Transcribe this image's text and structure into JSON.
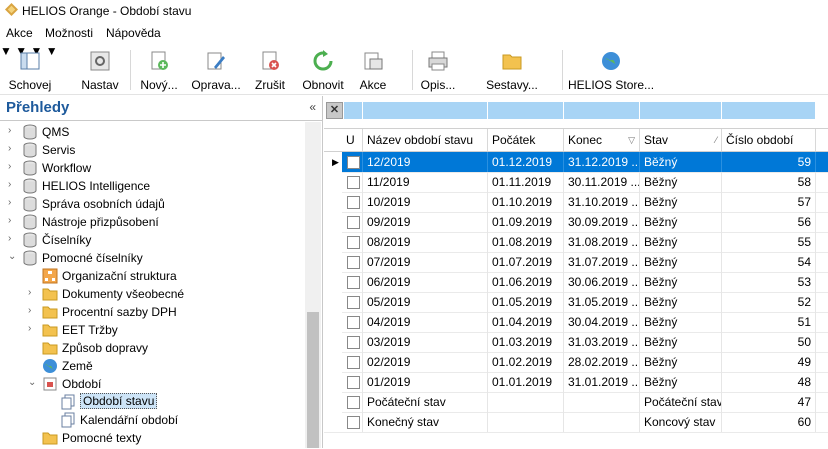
{
  "window": {
    "title": "HELIOS Orange - Období stavu"
  },
  "menu": [
    "Akce",
    "Možnosti",
    "Nápověda"
  ],
  "toolbar": [
    {
      "label": "Schovej",
      "icon": "hide-panel-icon",
      "dropdown": true
    },
    {
      "label": "Nastav",
      "icon": "settings-icon",
      "dropdown": false
    },
    {
      "label": "Nový...",
      "icon": "new-document-icon",
      "dropdown": false
    },
    {
      "label": "Oprava...",
      "icon": "edit-icon",
      "dropdown": false
    },
    {
      "label": "Zrušit",
      "icon": "delete-icon",
      "dropdown": false
    },
    {
      "label": "Obnovit",
      "icon": "refresh-icon",
      "dropdown": false
    },
    {
      "label": "Akce",
      "icon": "actions-icon",
      "dropdown": true
    },
    {
      "label": "Opis...",
      "icon": "print-icon",
      "dropdown": true
    },
    {
      "label": "Sestavy...",
      "icon": "folder-icon",
      "dropdown": true
    },
    {
      "label": "HELIOS Store...",
      "icon": "globe-icon",
      "dropdown": false
    }
  ],
  "left_panel": {
    "title": "Přehledy",
    "collapse": "«",
    "tree": [
      {
        "label": "QMS",
        "level": 0,
        "icon": "database-icon",
        "expander": ">"
      },
      {
        "label": "Servis",
        "level": 0,
        "icon": "database-icon",
        "expander": ">"
      },
      {
        "label": "Workflow",
        "level": 0,
        "icon": "database-icon",
        "expander": ">"
      },
      {
        "label": "HELIOS Intelligence",
        "level": 0,
        "icon": "database-icon",
        "expander": ">"
      },
      {
        "label": "Správa osobních údajů",
        "level": 0,
        "icon": "database-icon",
        "expander": ">"
      },
      {
        "label": "Nástroje přizpůsobení",
        "level": 0,
        "icon": "database-icon",
        "expander": ">"
      },
      {
        "label": "Číselníky",
        "level": 0,
        "icon": "database-icon",
        "expander": ">"
      },
      {
        "label": "Pomocné číselníky",
        "level": 0,
        "icon": "database-icon",
        "expander": "v"
      },
      {
        "label": "Organizační struktura",
        "level": 1,
        "icon": "org-chart-icon",
        "expander": ""
      },
      {
        "label": "Dokumenty všeobecné",
        "level": 1,
        "icon": "folder-icon",
        "expander": ">"
      },
      {
        "label": "Procentní sazby DPH",
        "level": 1,
        "icon": "folder-icon",
        "expander": ">"
      },
      {
        "label": "EET Tržby",
        "level": 1,
        "icon": "folder-icon",
        "expander": ">"
      },
      {
        "label": "Způsob dopravy",
        "level": 1,
        "icon": "folder-icon",
        "expander": ""
      },
      {
        "label": "Země",
        "level": 1,
        "icon": "globe-icon",
        "expander": ""
      },
      {
        "label": "Období",
        "level": 1,
        "icon": "calendar-icon",
        "expander": "v"
      },
      {
        "label": "Období stavu",
        "level": 2,
        "icon": "pages-icon",
        "expander": "",
        "selected": true
      },
      {
        "label": "Kalendářní období",
        "level": 2,
        "icon": "pages-icon",
        "expander": ""
      },
      {
        "label": "Pomocné texty",
        "level": 1,
        "icon": "folder-icon",
        "expander": ""
      }
    ]
  },
  "grid": {
    "columns": [
      {
        "label": "U"
      },
      {
        "label": "Název období stavu"
      },
      {
        "label": "Počátek"
      },
      {
        "label": "Konec",
        "sort": "▽"
      },
      {
        "label": "Stav",
        "sort": "⁄"
      },
      {
        "label": "Číslo období"
      }
    ],
    "rows": [
      {
        "name": "12/2019",
        "start": "01.12.2019",
        "end": "31.12.2019 ...",
        "state": "Běžný",
        "num": "59",
        "selected": true
      },
      {
        "name": "11/2019",
        "start": "01.11.2019",
        "end": "30.11.2019 ...",
        "state": "Běžný",
        "num": "58"
      },
      {
        "name": "10/2019",
        "start": "01.10.2019",
        "end": "31.10.2019 ...",
        "state": "Běžný",
        "num": "57"
      },
      {
        "name": "09/2019",
        "start": "01.09.2019",
        "end": "30.09.2019 ...",
        "state": "Běžný",
        "num": "56"
      },
      {
        "name": "08/2019",
        "start": "01.08.2019",
        "end": "31.08.2019 ...",
        "state": "Běžný",
        "num": "55"
      },
      {
        "name": "07/2019",
        "start": "01.07.2019",
        "end": "31.07.2019 ...",
        "state": "Běžný",
        "num": "54"
      },
      {
        "name": "06/2019",
        "start": "01.06.2019",
        "end": "30.06.2019 ...",
        "state": "Běžný",
        "num": "53"
      },
      {
        "name": "05/2019",
        "start": "01.05.2019",
        "end": "31.05.2019 ...",
        "state": "Běžný",
        "num": "52"
      },
      {
        "name": "04/2019",
        "start": "01.04.2019",
        "end": "30.04.2019 ...",
        "state": "Běžný",
        "num": "51"
      },
      {
        "name": "03/2019",
        "start": "01.03.2019",
        "end": "31.03.2019 ...",
        "state": "Běžný",
        "num": "50"
      },
      {
        "name": "02/2019",
        "start": "01.02.2019",
        "end": "28.02.2019 ...",
        "state": "Běžný",
        "num": "49"
      },
      {
        "name": "01/2019",
        "start": "01.01.2019",
        "end": "31.01.2019 ...",
        "state": "Běžný",
        "num": "48"
      },
      {
        "name": "Počáteční stav",
        "start": "",
        "end": "",
        "state": "Počáteční stav",
        "num": "47"
      },
      {
        "name": "Konečný stav",
        "start": "",
        "end": "",
        "state": "Koncový stav",
        "num": "60"
      }
    ]
  }
}
